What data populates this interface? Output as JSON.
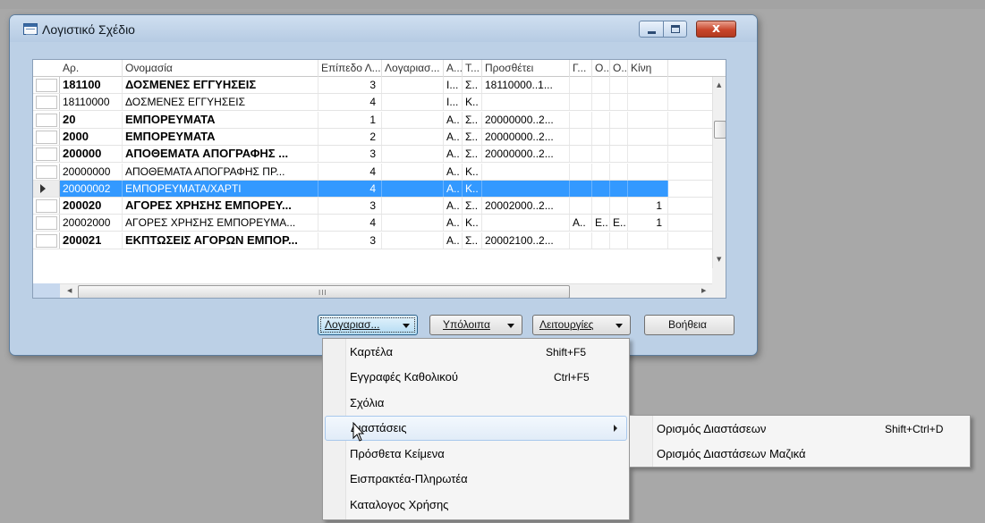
{
  "window": {
    "title": "Λογιστικό Σχέδιο",
    "close_glyph": "x"
  },
  "grid": {
    "columns": [
      "Αρ.",
      "Ονομασία",
      "Επίπεδο Λ...",
      "Λογαριασ...",
      "Α...",
      "Τ...",
      "Προσθέτει",
      "Γ...",
      "Ο...",
      "Ο...",
      "Κίνη"
    ],
    "rows": [
      {
        "no": "181100",
        "name": "ΔΟΣΜΕΝΕΣ ΕΓΓΥΗΣΕΙΣ",
        "level": "3",
        "acc": "",
        "a": "I...",
        "t": "Σ..",
        "adds": "18110000..1...",
        "g": "",
        "o1": "",
        "o2": "",
        "k": "",
        "bold": true
      },
      {
        "no": "18110000",
        "name": "ΔΟΣΜΕΝΕΣ ΕΓΓΥΗΣΕΙΣ",
        "level": "4",
        "acc": "",
        "a": "I...",
        "t": "K..",
        "adds": "",
        "g": "",
        "o1": "",
        "o2": "",
        "k": "",
        "bold": false
      },
      {
        "no": "20",
        "name": "ΕΜΠΟΡΕΥΜΑΤΑ",
        "level": "1",
        "acc": "",
        "a": "A..",
        "t": "Σ..",
        "adds": "20000000..2...",
        "g": "",
        "o1": "",
        "o2": "",
        "k": "",
        "bold": true
      },
      {
        "no": "2000",
        "name": "ΕΜΠΟΡΕΥΜΑΤΑ",
        "level": "2",
        "acc": "",
        "a": "A..",
        "t": "Σ..",
        "adds": "20000000..2...",
        "g": "",
        "o1": "",
        "o2": "",
        "k": "",
        "bold": true
      },
      {
        "no": "200000",
        "name": "ΑΠΟΘΕΜΑΤΑ ΑΠΟΓΡΑΦΗΣ ...",
        "level": "3",
        "acc": "",
        "a": "A..",
        "t": "Σ..",
        "adds": "20000000..2...",
        "g": "",
        "o1": "",
        "o2": "",
        "k": "",
        "bold": true
      },
      {
        "no": "20000000",
        "name": "ΑΠΟΘΕΜΑΤΑ ΑΠΟΓΡΑΦΗΣ ΠΡ...",
        "level": "4",
        "acc": "",
        "a": "A..",
        "t": "K..",
        "adds": "",
        "g": "",
        "o1": "",
        "o2": "",
        "k": "",
        "bold": false
      },
      {
        "no": "20000002",
        "name": "ΕΜΠΟΡΕΥΜΑΤΑ/ΧΑΡΤΙ",
        "level": "4",
        "acc": "",
        "a": "A..",
        "t": "K..",
        "adds": "",
        "g": "",
        "o1": "",
        "o2": "",
        "k": "",
        "bold": false,
        "selected": true
      },
      {
        "no": "200020",
        "name": "ΑΓΟΡΕΣ ΧΡΗΣΗΣ ΕΜΠΟΡΕΥ...",
        "level": "3",
        "acc": "",
        "a": "A..",
        "t": "Σ..",
        "adds": "20002000..2...",
        "g": "",
        "o1": "",
        "o2": "",
        "k": "1",
        "bold": true
      },
      {
        "no": "20002000",
        "name": "ΑΓΟΡΕΣ ΧΡΗΣΗΣ ΕΜΠΟΡΕΥΜΑ...",
        "level": "4",
        "acc": "",
        "a": "A..",
        "t": "K..",
        "adds": "",
        "g": "A..",
        "o1": "E..",
        "o2": "E..",
        "k": "1",
        "bold": false
      },
      {
        "no": "200021",
        "name": "ΕΚΠΤΩΣΕΙΣ ΑΓΟΡΩΝ ΕΜΠΟΡ...",
        "level": "3",
        "acc": "",
        "a": "A..",
        "t": "Σ..",
        "adds": "20002100..2...",
        "g": "",
        "o1": "",
        "o2": "",
        "k": "",
        "bold": true
      }
    ],
    "hscroll_grip": "III"
  },
  "buttons": {
    "account": "Λογαριασ...",
    "balances": "Υπόλοιπα",
    "functions": "Λειτουργίες",
    "help": "Βοήθεια"
  },
  "menu": {
    "items": [
      {
        "label": "Καρτέλα",
        "shortcut": "Shift+F5"
      },
      {
        "label": "Εγγραφές Καθολικού",
        "shortcut": "Ctrl+F5"
      },
      {
        "label": "Σχόλια",
        "shortcut": ""
      },
      {
        "label": "Διαστάσεις",
        "shortcut": "",
        "submenu": true,
        "hover": true
      },
      {
        "label": "Πρόσθετα Κείμενα",
        "shortcut": ""
      },
      {
        "label": "Εισπρακτέα-Πληρωτέα",
        "shortcut": ""
      },
      {
        "label": "Καταλογος Χρήσης",
        "shortcut": ""
      }
    ]
  },
  "submenu": {
    "items": [
      {
        "label": "Ορισμός Διαστάσεων",
        "shortcut": "Shift+Ctrl+D"
      },
      {
        "label": "Ορισμός Διαστάσεων Μαζικά",
        "shortcut": ""
      }
    ]
  },
  "colors": {
    "selection": "#3399ff",
    "window_frame": "#bcd0e6",
    "close_button": "#c8462b"
  }
}
